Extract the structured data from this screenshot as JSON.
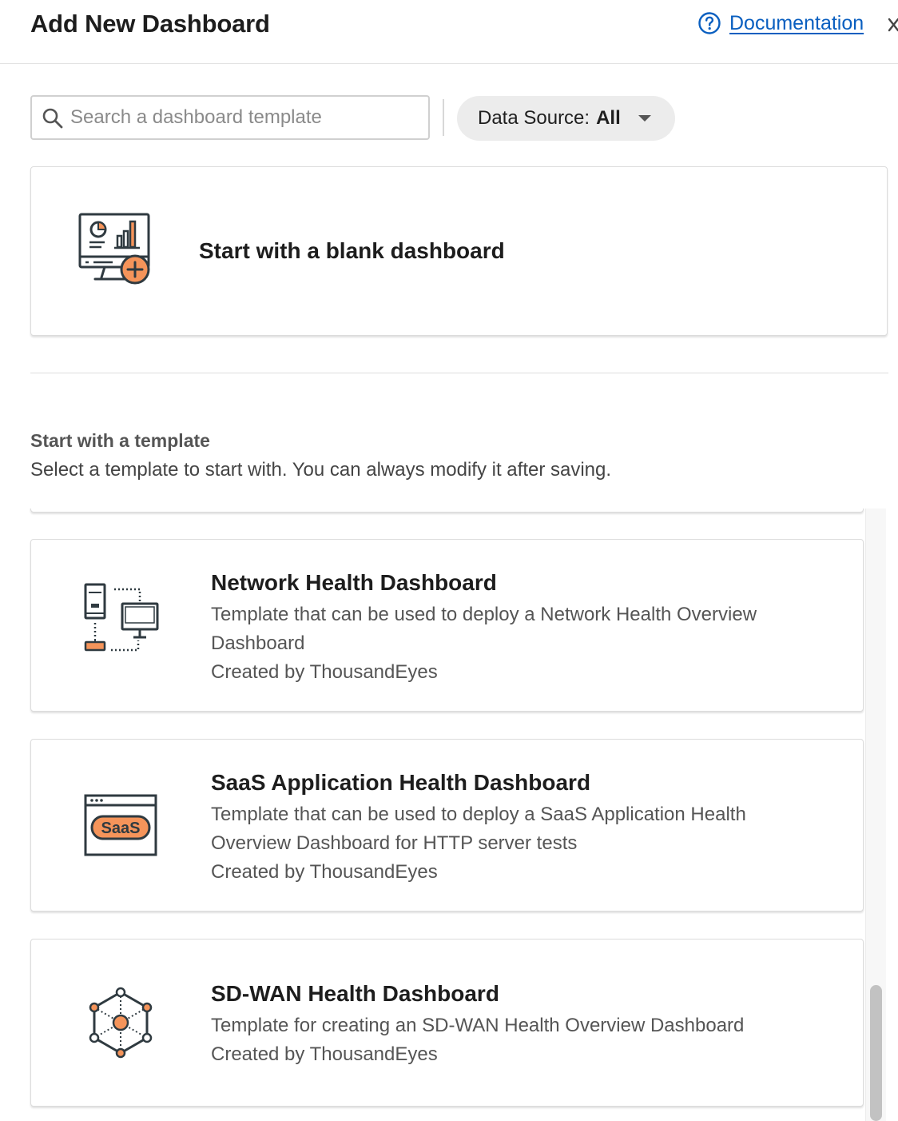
{
  "header": {
    "title": "Add New Dashboard",
    "documentation_label": "Documentation"
  },
  "toolbar": {
    "search_placeholder": "Search a dashboard template",
    "data_source_label": "Data Source:",
    "data_source_value": "All"
  },
  "blank": {
    "title": "Start with a blank dashboard"
  },
  "templates_section": {
    "title": "Start with a template",
    "subtitle": "Select a template to start with. You can always modify it after saving."
  },
  "templates": [
    {
      "name": "Network Health Dashboard",
      "description": "Template that can be used to deploy a Network Health Overview Dashboard",
      "created_by": "Created by ThousandEyes",
      "icon": "network-devices-icon"
    },
    {
      "name": "SaaS Application Health Dashboard",
      "description": "Template that can be used to deploy a SaaS Application Health Overview Dashboard for HTTP server tests",
      "created_by": "Created by ThousandEyes",
      "icon": "saas-window-icon",
      "icon_text": "SaaS"
    },
    {
      "name": "SD-WAN Health Dashboard",
      "description": "Template for creating an SD-WAN Health Overview Dashboard",
      "created_by": "Created by ThousandEyes",
      "icon": "sdwan-hexagon-icon"
    }
  ],
  "colors": {
    "accent_orange": "#f5945a",
    "icon_stroke": "#2f3a40",
    "link_blue": "#0a5fc0"
  }
}
